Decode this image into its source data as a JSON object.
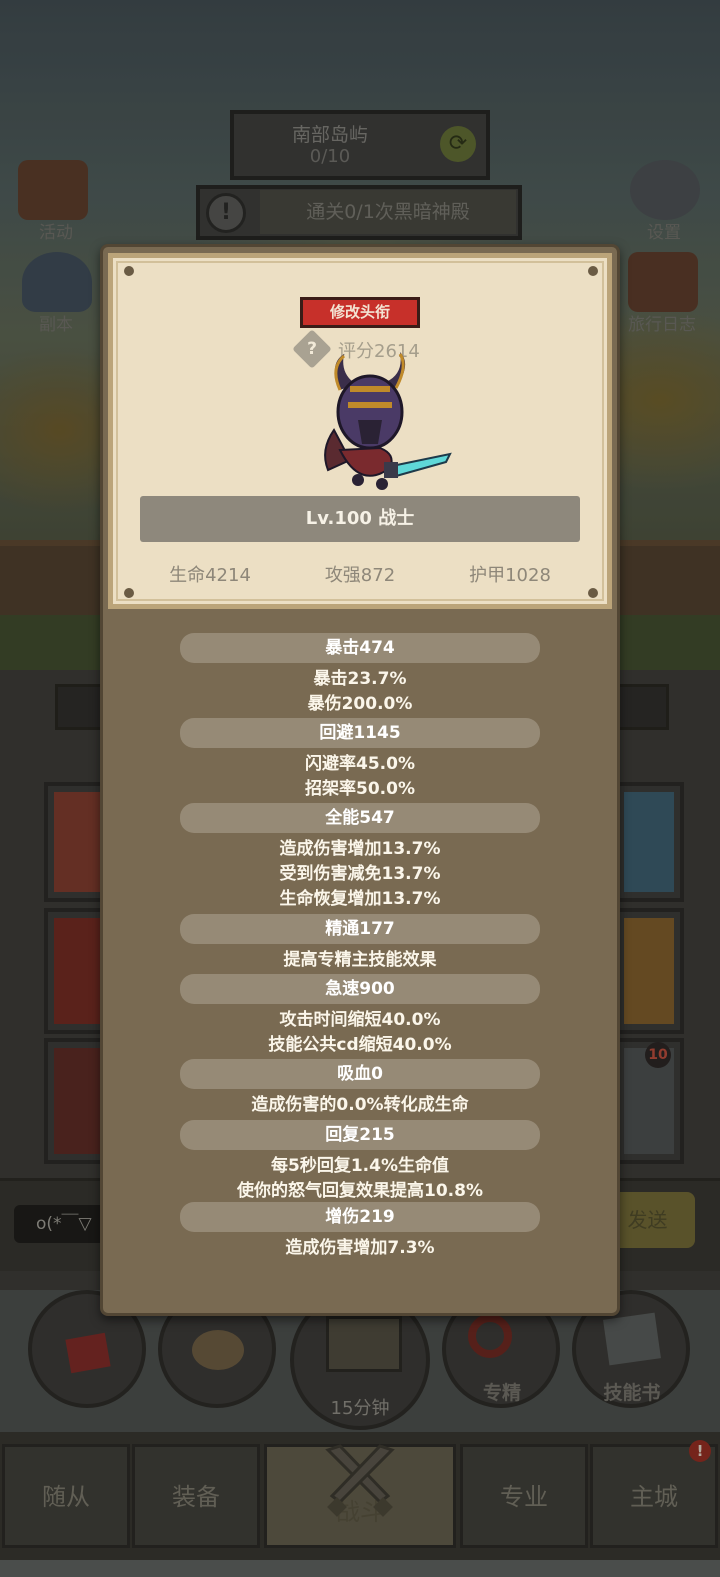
{
  "hud": {
    "location_name": "南部岛屿",
    "location_progress": "0/10",
    "quest_text": "通关0/1次黑暗神殿",
    "quest_icon": "!",
    "left_menu": [
      "活动",
      "副本"
    ],
    "right_menu": [
      "设置",
      "旅行日志"
    ]
  },
  "chat": {
    "input_text": "o(*￣▽",
    "send_label": "发送"
  },
  "actions": {
    "chest_timer": "15分钟",
    "mastery_label": "专精",
    "skillbook_label": "技能书"
  },
  "tabs": [
    "随从",
    "装备",
    "战斗",
    "专业",
    "主城"
  ],
  "active_tab": "战斗",
  "tab_badge": "!",
  "slot_badge": "10",
  "modal": {
    "change_title_button": "修改头衔",
    "help_icon": "?",
    "score": "评分2614",
    "hero_line": "Lv.100 战士",
    "base_stats": [
      "生命4214",
      "攻强872",
      "护甲1028"
    ],
    "stats": [
      {
        "header": "暴击474",
        "lines": [
          "暴击23.7%",
          "暴伤200.0%"
        ]
      },
      {
        "header": "回避1145",
        "lines": [
          "闪避率45.0%",
          "招架率50.0%"
        ]
      },
      {
        "header": "全能547",
        "lines": [
          "造成伤害增加13.7%",
          "受到伤害减免13.7%",
          "生命恢复增加13.7%"
        ]
      },
      {
        "header": "精通177",
        "lines": [
          "提高专精主技能效果"
        ]
      },
      {
        "header": "急速900",
        "lines": [
          "攻击时间缩短40.0%",
          "技能公共cd缩短40.0%"
        ]
      },
      {
        "header": "吸血0",
        "lines": [
          "造成伤害的0.0%转化成生命"
        ]
      },
      {
        "header": "回复215",
        "lines": [
          "每5秒回复1.4%生命值",
          "使你的怒气回复效果提高10.8%"
        ]
      },
      {
        "header": "增伤219",
        "lines": [
          "造成伤害增加7.3%"
        ]
      }
    ]
  },
  "colors": {
    "title_button": "#c7302a",
    "parchment": "#ecdfc4",
    "modal_body": "#796a52",
    "stat_bar": "#968a76"
  }
}
